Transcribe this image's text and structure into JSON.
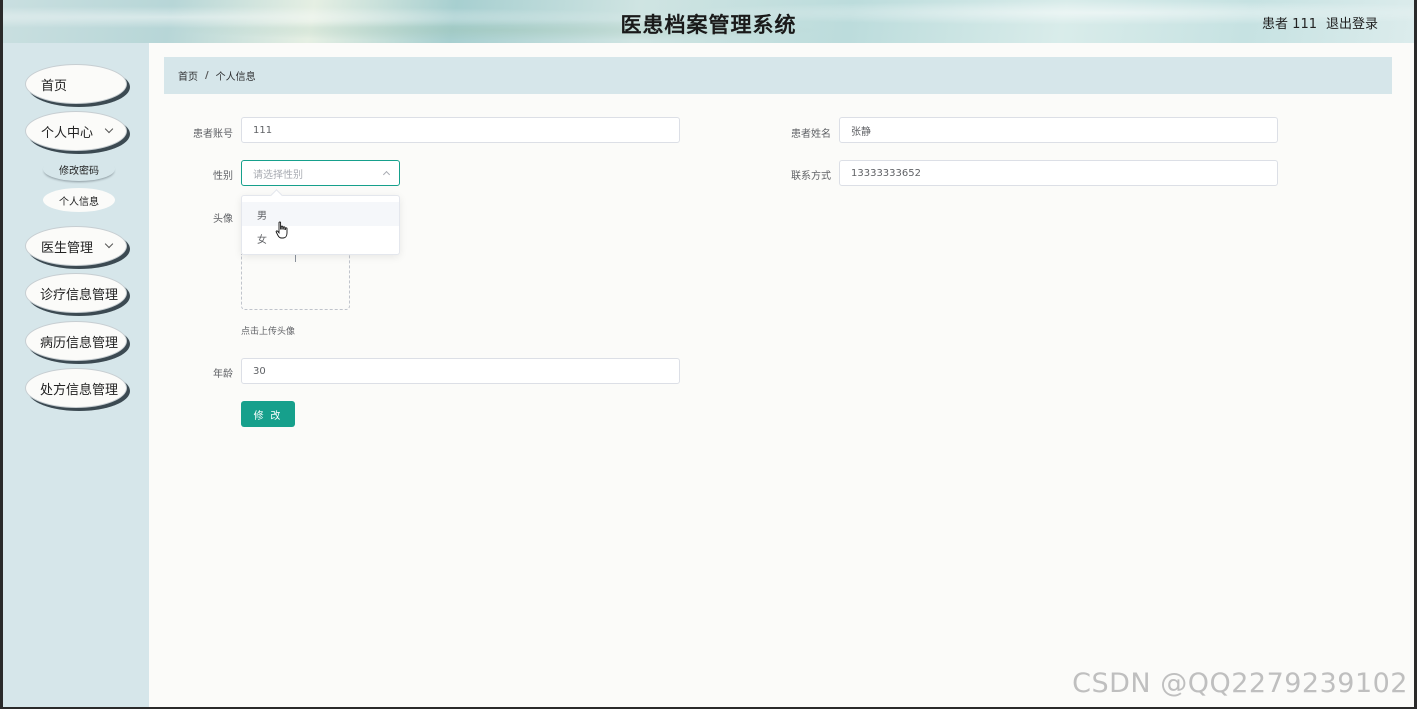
{
  "header": {
    "title": "医患档案管理系统",
    "user": "患者 111",
    "logout": "退出登录"
  },
  "sidebar": {
    "items": [
      {
        "label": "首页"
      },
      {
        "label": "个人中心"
      },
      {
        "label": "修改密码"
      },
      {
        "label": "个人信息"
      },
      {
        "label": "医生管理"
      },
      {
        "label": "诊疗信息管理"
      },
      {
        "label": "病历信息管理"
      },
      {
        "label": "处方信息管理"
      }
    ]
  },
  "breadcrumb": {
    "home": "首页",
    "sep": "/",
    "current": "个人信息"
  },
  "form": {
    "account_label": "患者账号",
    "account_value": "111",
    "name_label": "患者姓名",
    "name_value": "张静",
    "gender_label": "性别",
    "gender_placeholder": "请选择性别",
    "gender_options": [
      "男",
      "女"
    ],
    "phone_label": "联系方式",
    "phone_value": "13333333652",
    "avatar_label": "头像",
    "avatar_tip": "点击上传头像",
    "age_label": "年龄",
    "age_value": "30",
    "submit_label": "修 改"
  },
  "watermark": "CSDN @QQ2279239102",
  "colors": {
    "accent": "#16a08c",
    "sidebar_bg": "#d6e6ea"
  }
}
